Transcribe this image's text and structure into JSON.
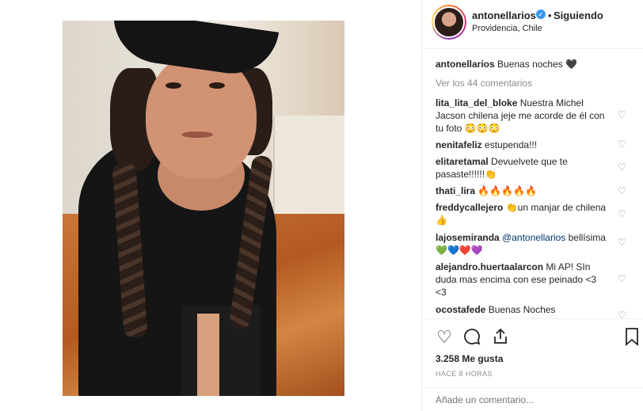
{
  "post": {
    "username": "antonellarios",
    "separator": "•",
    "follow_status": "Siguiendo",
    "location": "Providencia, Chile",
    "caption_text": "Buenas noches 🖤",
    "view_comments": "Ver los 44 comentarios",
    "likes": "3.258 Me gusta",
    "timestamp": "HACE 8 HORAS",
    "comment_placeholder": "Añade un comentario...",
    "verified_icon": "verified-badge-icon"
  },
  "comments": [
    {
      "user": "lita_lita_del_bloke",
      "text": "Nuestra Michel Jacson chilena jeje me acorde de él con tu foto 😳😳😳"
    },
    {
      "user": "nenitafeliz",
      "text": "estupenda!!!"
    },
    {
      "user": "elitaretamal",
      "text": "Devuelvete que te pasaste!!!!!!👏"
    },
    {
      "user": "thati_lira",
      "text": "🔥🔥🔥🔥🔥"
    },
    {
      "user": "freddycallejero",
      "text": "👏un manjar de chilena👍"
    },
    {
      "user": "lajosemiranda",
      "mention": "@antonellarios",
      "text": "bellísima 💚💙❤️💜"
    },
    {
      "user": "alejandro.huertaalarcon",
      "text": "Mi AP! SIn duda mas encima con ese peinado <3 <3"
    },
    {
      "user": "ocostafede",
      "text": "Buenas Noches"
    }
  ],
  "colors": {
    "accent": "#3897f0",
    "muted": "#8e8e8e",
    "text": "#262626",
    "border": "#efefef"
  }
}
